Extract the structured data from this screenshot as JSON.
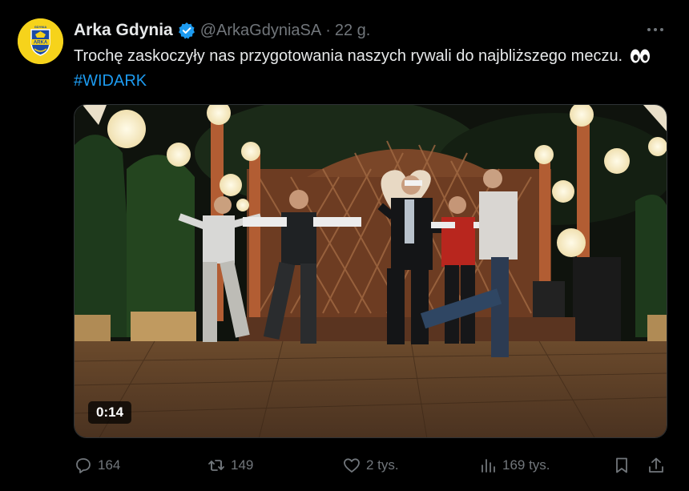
{
  "tweet": {
    "author_name": "Arka Gdynia",
    "handle": "@ArkaGdyniaSA",
    "separator": "·",
    "time": "22 g.",
    "text_main": "Trochę zaskoczyły nas przygotowania naszych rywali do najbliższego meczu.",
    "hashtag": "#WIDARK",
    "avatar_label": "ARKA",
    "avatar_top_label": "GDYNIA",
    "video_duration": "0:14",
    "icons": {
      "verified": "verified-badge-icon",
      "more": "more-icon",
      "eyes": "eyes-emoji-icon"
    }
  },
  "actions": {
    "replies": "164",
    "retweets": "149",
    "likes": "2 tys.",
    "views": "169 tys."
  },
  "colors": {
    "background": "#000000",
    "text": "#e7e9ea",
    "muted": "#71767b",
    "accent": "#1d9bf0",
    "avatar_bg": "#f6d31b"
  }
}
